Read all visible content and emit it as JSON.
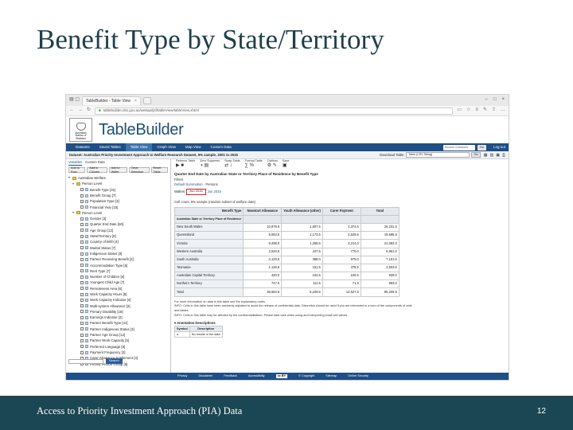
{
  "slide": {
    "title": "Benefit Type by State/Territory",
    "footer": "Access to Priority Investment Approach (PIA) Data",
    "page_number": "12"
  },
  "browser": {
    "tab_title": "TableBuilder - Table View",
    "url": "tablebuilder.dss.gov.au/webapi/jsf/tableView/tableView.xhtml"
  },
  "header": {
    "logo_lines": [
      "Australian",
      "Bureau of",
      "Statistics"
    ],
    "app_title": "TableBuilder"
  },
  "menu": {
    "items": [
      "Datasets",
      "Saved Tables",
      "Table View",
      "Graph View",
      "Map View",
      "Custom Data"
    ],
    "active": "Table View",
    "search_placeholder": "Search Datasets",
    "go_label": "Go",
    "logout_label": "Log out"
  },
  "dataset_bar": {
    "dataset": "Dataset: Australian Priority Investment Approach to Welfare Research Dataset, 5% sample, 2001 to 2015",
    "download_label": "Download Table",
    "download_value": "Table (CSV String)",
    "go_label": "Go"
  },
  "left_panel": {
    "tabs": [
      "Variables",
      "Custom Data"
    ],
    "buttons": [
      "Add to Row",
      "Add to Column",
      "Add to Wafer",
      "Clear Selection",
      "Reset Table"
    ],
    "tree": [
      {
        "label": "Australian Welfare",
        "type": "fold",
        "level": 0
      },
      {
        "label": "Person Level",
        "type": "fold",
        "level": 1
      },
      {
        "label": "Benefit Type [31]",
        "type": "leaf",
        "level": 2
      },
      {
        "label": "Benefit Group [7]",
        "type": "leaf",
        "level": 2
      },
      {
        "label": "Population Type [3]",
        "type": "leaf",
        "level": 2
      },
      {
        "label": "Financial Year [15]",
        "type": "leaf",
        "level": 2
      },
      {
        "label": "Person Level",
        "type": "fold",
        "level": 1
      },
      {
        "label": "Gender [3]",
        "type": "leaf",
        "level": 2
      },
      {
        "label": "Quarter End Date [60]",
        "type": "leaf",
        "level": 2
      },
      {
        "label": "Age Group [12]",
        "type": "leaf",
        "level": 2
      },
      {
        "label": "State/Territory [9]",
        "type": "leaf",
        "level": 2
      },
      {
        "label": "Country of Birth [4]",
        "type": "leaf",
        "level": 2
      },
      {
        "label": "Marital Status [7]",
        "type": "leaf",
        "level": 2
      },
      {
        "label": "Indigenous Status [3]",
        "type": "leaf",
        "level": 2
      },
      {
        "label": "Partner Receiving Benefit [3]",
        "type": "leaf",
        "level": 2
      },
      {
        "label": "Accommodation Type [6]",
        "type": "leaf",
        "level": 2
      },
      {
        "label": "Rent Type [7]",
        "type": "leaf",
        "level": 2
      },
      {
        "label": "Number of Children [6]",
        "type": "leaf",
        "level": 2
      },
      {
        "label": "Youngest Child Age [7]",
        "type": "leaf",
        "level": 2
      },
      {
        "label": "Remoteness Area [6]",
        "type": "leaf",
        "level": 2
      },
      {
        "label": "Work Capacity Hours [5]",
        "type": "leaf",
        "level": 2
      },
      {
        "label": "Work Capacity Indicator [4]",
        "type": "leaf",
        "level": 2
      },
      {
        "label": "Multi-system Allowance [3]",
        "type": "leaf",
        "level": 2
      },
      {
        "label": "Primary Disability [18]",
        "type": "leaf",
        "level": 2
      },
      {
        "label": "Earnings Indicator [3]",
        "type": "leaf",
        "level": 2
      },
      {
        "label": "Partner Benefit Type [31]",
        "type": "leaf",
        "level": 2
      },
      {
        "label": "Partner Indigenous Status [3]",
        "type": "leaf",
        "level": 2
      },
      {
        "label": "Partner Age Group [12]",
        "type": "leaf",
        "level": 2
      },
      {
        "label": "Partner Work Capacity [5]",
        "type": "leaf",
        "level": 2
      },
      {
        "label": "Preferred Language [8]",
        "type": "leaf",
        "level": 2
      },
      {
        "label": "Payment Frequency [3]",
        "type": "leaf",
        "level": 2
      },
      {
        "label": "Carer Allowance Entitlement [3]",
        "type": "leaf",
        "level": 2
      },
      {
        "label": "Priority Person Group [8]",
        "type": "leaf",
        "level": 2
      }
    ],
    "bottom_go": "Search"
  },
  "toolbar": {
    "groups": [
      {
        "label": "Retrieve Table",
        "icons": "▶ ■"
      },
      {
        "label": "Zero Suppress",
        "icons": "◑ ▤"
      },
      {
        "label": "Swap Table",
        "icons": "⇄ ↕"
      },
      {
        "label": "Format Table",
        "icons": "∑ %"
      },
      {
        "label": "Options",
        "icons": "⚙ ✎"
      },
      {
        "label": "Save",
        "icons": "▣"
      }
    ]
  },
  "table_view": {
    "title": "Quarter End Date by Australian State or Territory Place of Residence by Benefit Type",
    "filters_label": "Filters",
    "filters_line1": "Default Summation",
    "filters_line2": "Persons",
    "wafer_label": "Wafers",
    "wafer_value": "Jun 2015",
    "wafer_extra": "Jun 2015",
    "cells_note": "Cell count, 5% sample (random subset of welfare data)",
    "column_header_label": "Benefit Type",
    "row_header_label": "Australian State or Territory Place of Residence",
    "columns": [
      "Newstart Allowance",
      "Youth Allowance (other)",
      "Carer Payment",
      "Total"
    ],
    "rows": [
      {
        "label": "New South Wales",
        "values": [
          "10,979.6",
          "1,507.5",
          "4,374.5",
          "26,231.5"
        ]
      },
      {
        "label": "Queensland",
        "values": [
          "8,083.5",
          "1,173.5",
          "2,529.5",
          "19,598.5"
        ]
      },
      {
        "label": "Victoria",
        "values": [
          "9,498.0",
          "1,258.5",
          "3,214.0",
          "21,082.0"
        ]
      },
      {
        "label": "Western Australia",
        "values": [
          "3,534.5",
          "447.5",
          "776.0",
          "6,961.0"
        ]
      },
      {
        "label": "South Australia",
        "values": [
          "3,129.5",
          "388.0",
          "975.0",
          "7,151.5"
        ]
      },
      {
        "label": "Tasmania",
        "values": [
          "1,126.5",
          "151.5",
          "378.5",
          "2,503.5"
        ]
      },
      {
        "label": "Australian Capital Territory",
        "values": [
          "420.0",
          "102.5",
          "100.5",
          "926.0"
        ]
      },
      {
        "label": "Northern Territory",
        "values": [
          "747.5",
          "111.5",
          "71.5",
          "993.0"
        ]
      },
      {
        "label": "Total",
        "values": [
          "36,584.5",
          "5,229.5",
          "12,527.5",
          "85,209.5"
        ]
      }
    ],
    "notes": [
      "For more information on data in this table see the explanatory notes.",
      "INFO: Cells in this table have been randomly adjusted to avoid the release of confidential data. Discretion should be used if you are interested in a sum of the components of cells and tables.",
      "INFO: Cells in this table may be affected by the confidentialisation. Please take care when using and interpreting small cell values."
    ],
    "annotation_title": "Annotation Descriptions",
    "annotation_headers": [
      "Symbol",
      "Description"
    ],
    "annotation_row": [
      "a",
      "No results in the data"
    ]
  },
  "app_footer": {
    "items": [
      "Privacy",
      "Disclaimer",
      "Feedback",
      "Accessibility",
      "© Copyright",
      "Sitemap",
      "Online Security"
    ],
    "cc": "cc BY"
  }
}
